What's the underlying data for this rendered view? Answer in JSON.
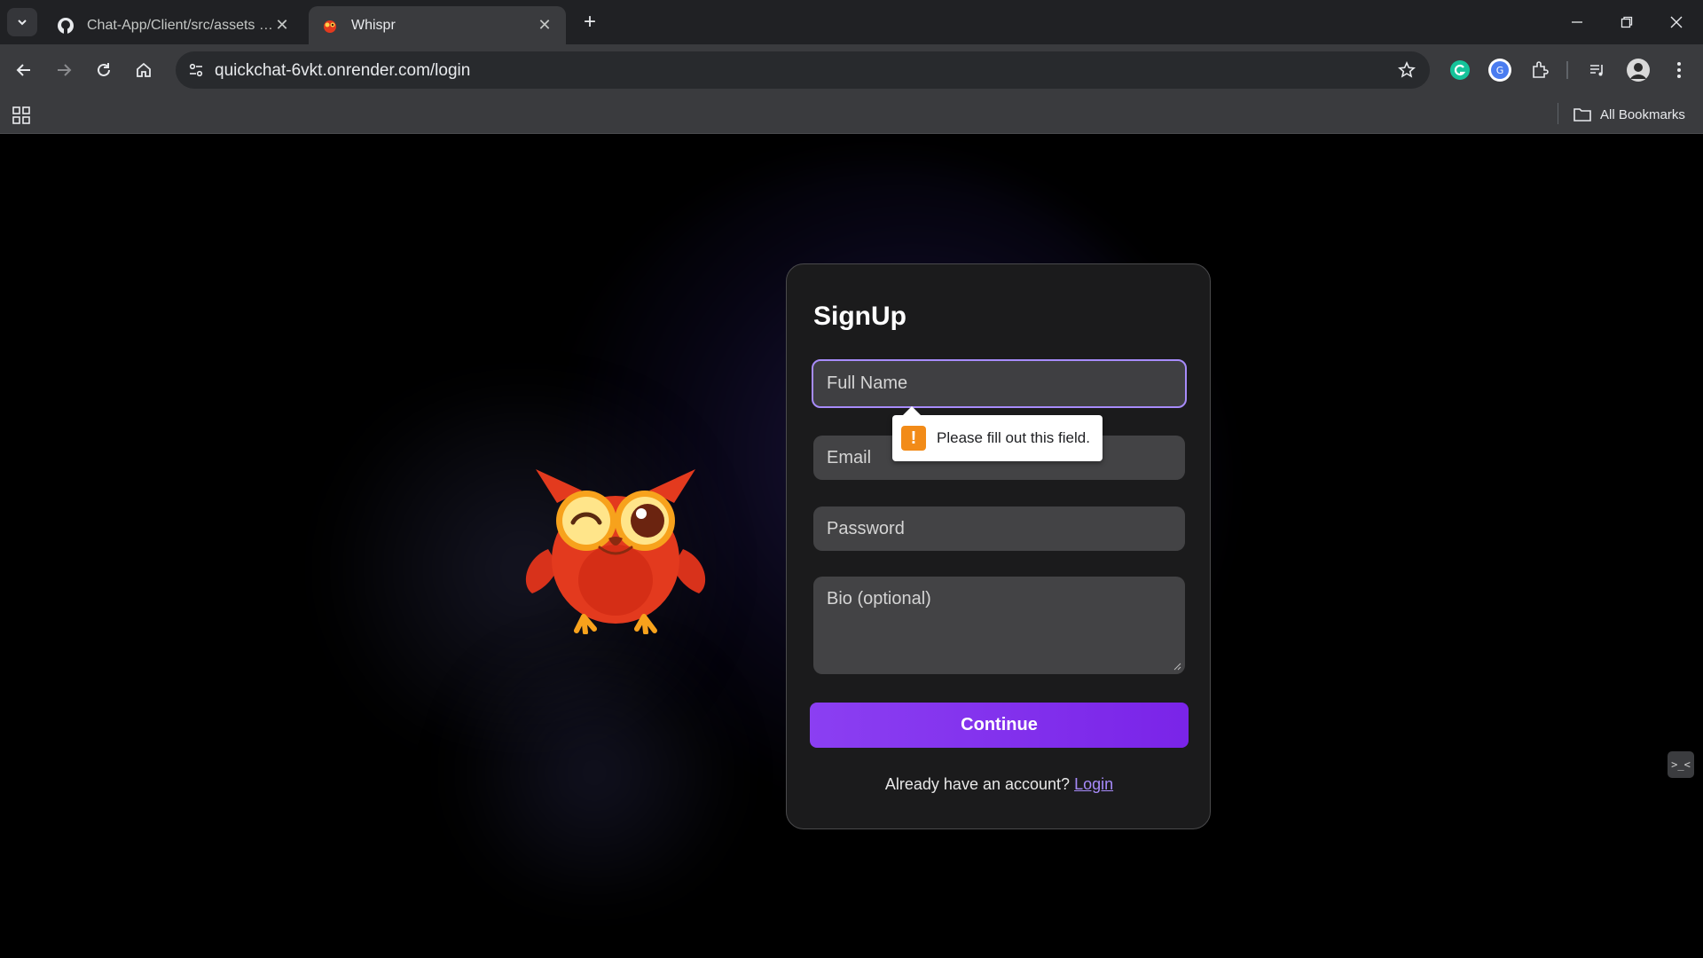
{
  "browser": {
    "tabs": [
      {
        "title": "Chat-App/Client/src/assets at m",
        "favicon": "github-icon",
        "active": false
      },
      {
        "title": "Whispr",
        "favicon": "owl-favicon",
        "active": true
      }
    ],
    "url": "quickchat-6vkt.onrender.com/login",
    "bookmarks_label": "All Bookmarks"
  },
  "signup": {
    "title": "SignUp",
    "fullname_placeholder": "Full Name",
    "email_placeholder": "Email",
    "password_placeholder": "Password",
    "bio_placeholder": "Bio (optional)",
    "continue_label": "Continue",
    "already_text": "Already have an account?",
    "login_link": "Login"
  },
  "validation": {
    "message": "Please fill out this field.",
    "icon": "!"
  },
  "colors": {
    "accent": "#8b3ff2",
    "link": "#a78bfa",
    "warning": "#f28b18",
    "owl_body": "#e33a1e"
  }
}
